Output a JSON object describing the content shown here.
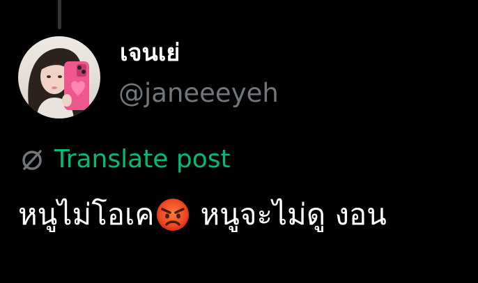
{
  "user": {
    "display_name": "เจนเย่",
    "handle": "@janeeeyeh",
    "avatar_icon": "profile-photo"
  },
  "translate": {
    "icon": "translate-globe-icon",
    "label": "Translate post",
    "color": "#00ba7c"
  },
  "post": {
    "text_part1": "หนูไม่โอเค",
    "emoji": "angry-face-emoji",
    "text_part2": "หนูจะไม่ดู งอน"
  },
  "colors": {
    "background": "#000000",
    "name": "#ffffff",
    "handle": "#71767b",
    "accent": "#00ba7c",
    "thread_line": "#333639"
  }
}
